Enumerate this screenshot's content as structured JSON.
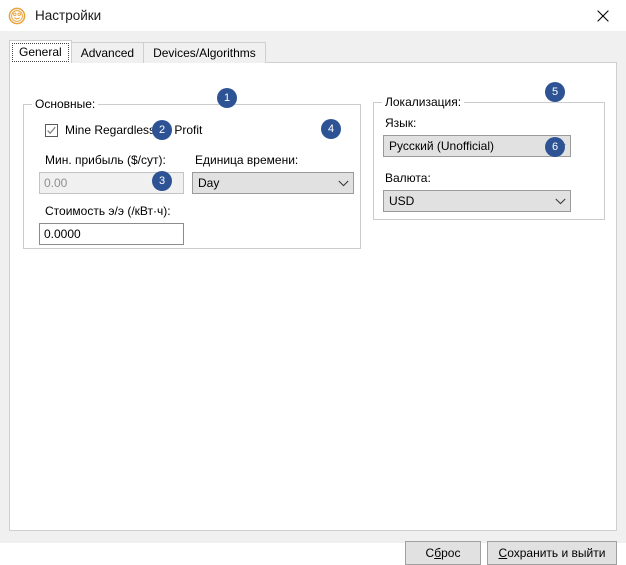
{
  "window": {
    "title": "Настройки",
    "icon": "coin-smiley-icon",
    "close_label": "×",
    "bg": "#f0f0f0"
  },
  "tabs": [
    {
      "label": "General",
      "active": true
    },
    {
      "label": "Advanced",
      "active": false
    },
    {
      "label": "Devices/Algorithms",
      "active": false
    }
  ],
  "groups": {
    "basic": {
      "title": "Основные:",
      "checkbox": {
        "label": "Mine Regardless Of Profit",
        "checked": true,
        "badge": "1"
      },
      "min_profit": {
        "label": "Мин. прибыль ($/сут):",
        "value": "0.00",
        "enabled": false,
        "badge": "2"
      },
      "power_cost": {
        "label": "Стоимость э/э (/кВт·ч):",
        "value": "0.0000",
        "enabled": true,
        "badge": "3"
      },
      "time_unit": {
        "label": "Единица времени:",
        "value": "Day",
        "badge": "4"
      }
    },
    "localization": {
      "title": "Локализация:",
      "language": {
        "label": "Язык:",
        "value": "Русский (Unofficial)",
        "badge": "5"
      },
      "currency": {
        "label": "Валюта:",
        "value": "USD",
        "badge": "6"
      }
    }
  },
  "footer": {
    "reset": {
      "pre": "С",
      "accel": "б",
      "post": "рос"
    },
    "save": {
      "pre": "",
      "accel": "С",
      "post": "охранить и выйти"
    }
  },
  "colors": {
    "badge_blue": "#2e5395",
    "window_bg": "#f0f0f0",
    "panel_bg": "#ffffff",
    "icon_gold": "#e8a33d"
  }
}
